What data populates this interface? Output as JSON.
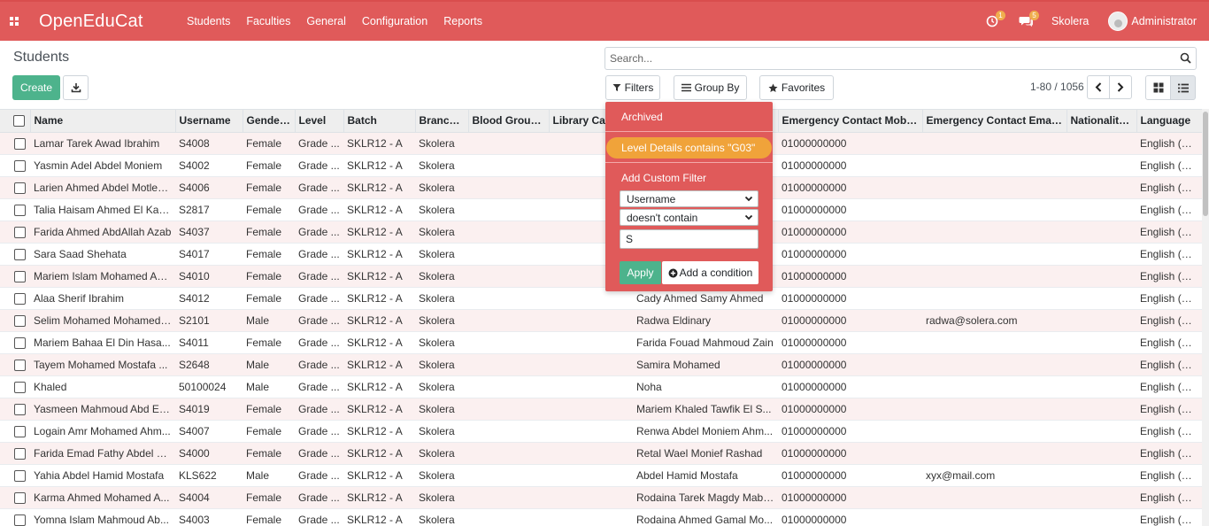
{
  "navbar": {
    "brand": "OpenEduCat",
    "menu": [
      "Students",
      "Faculties",
      "General",
      "Configuration",
      "Reports"
    ],
    "activity_badge": "1",
    "messages_badge": "5",
    "company": "Skolera",
    "user": "Administrator",
    "color": "#e05a5a"
  },
  "control_panel": {
    "breadcrumb": "Students",
    "create_label": "Create",
    "search_placeholder": "Search...",
    "filters_label": "Filters",
    "groupby_label": "Group By",
    "favorites_label": "Favorites",
    "pager": "1-80 / 1056"
  },
  "filters_dropdown": {
    "archived": "Archived",
    "active_filter": "Level Details contains \"G03\"",
    "custom_title": "Add Custom Filter",
    "field": "Username",
    "operator": "doesn't contain",
    "value": "S",
    "apply_label": "Apply",
    "add_condition_label": "Add a condition"
  },
  "table": {
    "headers": [
      "Name",
      "Username",
      "Gender...",
      "Level",
      "Batch",
      "Branch",
      "Blood Group...",
      "Library Ca",
      "",
      "Emergency Contact Mobil...",
      "Emergency Contact Emai...",
      "Nationality...",
      "Language"
    ],
    "rows": [
      [
        "Lamar Tarek Awad Ibrahim",
        "S4008",
        "Female",
        "Grade ...",
        "SKLR12 - A",
        "Skolera",
        "",
        "",
        "",
        "01000000000",
        "",
        "",
        "English (US)"
      ],
      [
        "Yasmin Adel Abdel Moniem",
        "S4002",
        "Female",
        "Grade ...",
        "SKLR12 - A",
        "Skolera",
        "",
        "",
        "",
        "01000000000",
        "",
        "",
        "English (US)"
      ],
      [
        "Larien Ahmed Abdel Motleb...",
        "S4006",
        "Female",
        "Grade ...",
        "SKLR12 - A",
        "Skolera",
        "",
        "",
        "",
        "01000000000",
        "",
        "",
        "English (US)"
      ],
      [
        "Talia Haisam Ahmed El Kab...",
        "S2817",
        "Female",
        "Grade ...",
        "SKLR12 - A",
        "Skolera",
        "",
        "",
        "",
        "01000000000",
        "",
        "",
        "English (US)"
      ],
      [
        "Farida Ahmed AbdAllah Azab",
        "S4037",
        "Female",
        "Grade ...",
        "SKLR12 - A",
        "Skolera",
        "",
        "",
        "",
        "01000000000",
        "",
        "",
        "English (US)"
      ],
      [
        "Sara Saad Shehata",
        "S4017",
        "Female",
        "Grade ...",
        "SKLR12 - A",
        "Skolera",
        "",
        "",
        "",
        "01000000000",
        "",
        "",
        "English (US)"
      ],
      [
        "Mariem Islam Mohamed Ah...",
        "S4010",
        "Female",
        "Grade ...",
        "SKLR12 - A",
        "Skolera",
        "",
        "",
        "",
        "01000000000",
        "",
        "",
        "English (US)"
      ],
      [
        "Alaa Sherif Ibrahim",
        "S4012",
        "Female",
        "Grade ...",
        "SKLR12 - A",
        "Skolera",
        "",
        "",
        "Cady Ahmed Samy Ahmed",
        "01000000000",
        "",
        "",
        "English (US)"
      ],
      [
        "Selim Mohamed Mohamed ...",
        "S2101",
        "Male",
        "Grade ...",
        "SKLR12 - A",
        "Skolera",
        "",
        "",
        "Radwa Eldinary",
        "01000000000",
        "radwa@solera.com",
        "",
        "English (US)"
      ],
      [
        "Mariem Bahaa El Din Hasa...",
        "S4011",
        "Female",
        "Grade ...",
        "SKLR12 - A",
        "Skolera",
        "",
        "",
        "Farida Fouad Mahmoud Zain",
        "01000000000",
        "",
        "",
        "English (US)"
      ],
      [
        "Tayem Mohamed Mostafa ...",
        "S2648",
        "Male",
        "Grade ...",
        "SKLR12 - A",
        "Skolera",
        "",
        "",
        "Samira Mohamed",
        "01000000000",
        "",
        "",
        "English (US)"
      ],
      [
        "Khaled",
        "50100024",
        "Male",
        "Grade ...",
        "SKLR12 - A",
        "Skolera",
        "",
        "",
        "Noha",
        "01000000000",
        "",
        "",
        "English (US)"
      ],
      [
        "Yasmeen Mahmoud Abd El-...",
        "S4019",
        "Female",
        "Grade ...",
        "SKLR12 - A",
        "Skolera",
        "",
        "",
        "Mariem Khaled Tawfik El S...",
        "01000000000",
        "",
        "",
        "English (US)"
      ],
      [
        "Logain Amr Mohamed Ahm...",
        "S4007",
        "Female",
        "Grade ...",
        "SKLR12 - A",
        "Skolera",
        "",
        "",
        "Renwa Abdel Moniem Ahm...",
        "01000000000",
        "",
        "",
        "English (US)"
      ],
      [
        "Farida Emad Fathy Abdel H...",
        "S4000",
        "Female",
        "Grade ...",
        "SKLR12 - A",
        "Skolera",
        "",
        "",
        "Retal Wael Monief Rashad",
        "01000000000",
        "",
        "",
        "English (US)"
      ],
      [
        "Yahia Abdel Hamid Mostafa",
        "KLS622",
        "Male",
        "Grade ...",
        "SKLR12 - A",
        "Skolera",
        "",
        "",
        "Abdel Hamid Mostafa",
        "01000000000",
        "xyx@mail.com",
        "",
        "English (US)"
      ],
      [
        "Karma Ahmed Mohamed A...",
        "S4004",
        "Female",
        "Grade ...",
        "SKLR12 - A",
        "Skolera",
        "",
        "",
        "Rodaina Tarek Magdy Mabr...",
        "01000000000",
        "",
        "",
        "English (US)"
      ],
      [
        "Yomna Islam Mahmoud Ab...",
        "S4003",
        "Female",
        "Grade ...",
        "SKLR12 - A",
        "Skolera",
        "",
        "",
        "Rodaina Ahmed Gamal Mo...",
        "01000000000",
        "",
        "",
        "English (US)"
      ]
    ]
  }
}
